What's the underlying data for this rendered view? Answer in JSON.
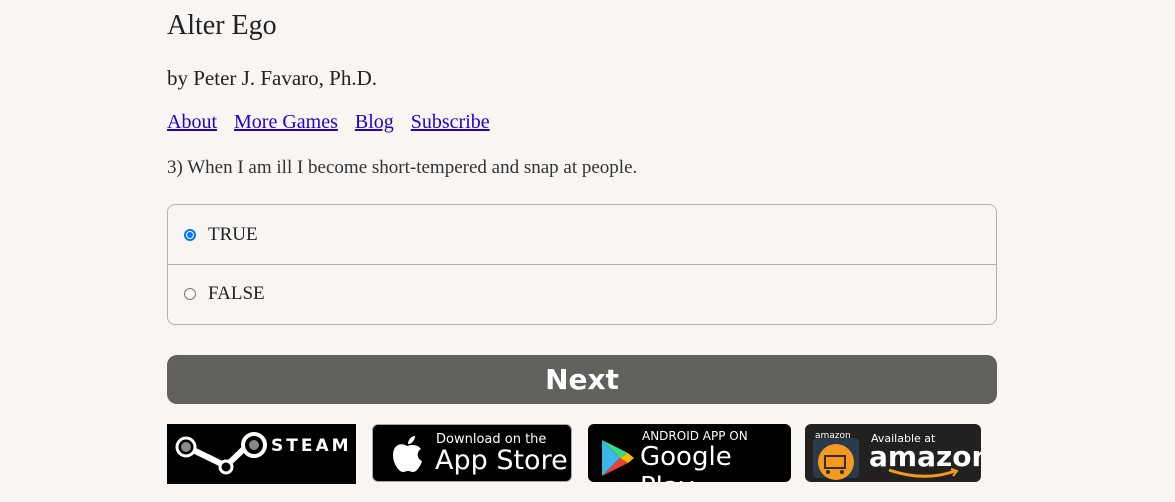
{
  "header": {
    "title": "Alter Ego",
    "author": "by Peter J. Favaro, Ph.D."
  },
  "nav": {
    "links": [
      "About",
      "More Games",
      "Blog",
      "Subscribe"
    ]
  },
  "question": {
    "text": "3) When I am ill I become short-tempered and snap at people.",
    "options": [
      {
        "label": "TRUE",
        "selected": true
      },
      {
        "label": "FALSE",
        "selected": false
      }
    ]
  },
  "next_button": {
    "label": "Next"
  },
  "store_badges": {
    "steam": {
      "word": "STEAM",
      "icon": "steam-logo-icon"
    },
    "appstore": {
      "small": "Download on the",
      "big": "App Store",
      "icon": "apple-icon"
    },
    "googleplay": {
      "small": "ANDROID APP ON",
      "big": "Google Play",
      "icon": "google-play-icon"
    },
    "amazon": {
      "logo": "amazon",
      "small": "Available at",
      "big": "amazon",
      "icon": "amazon-cart-icon"
    }
  },
  "colors": {
    "background": "#f8f5f2",
    "link": "#2200cc",
    "button": "#62615e",
    "radio_accent": "#0075ff",
    "amazon_orange": "#f29a1f"
  }
}
